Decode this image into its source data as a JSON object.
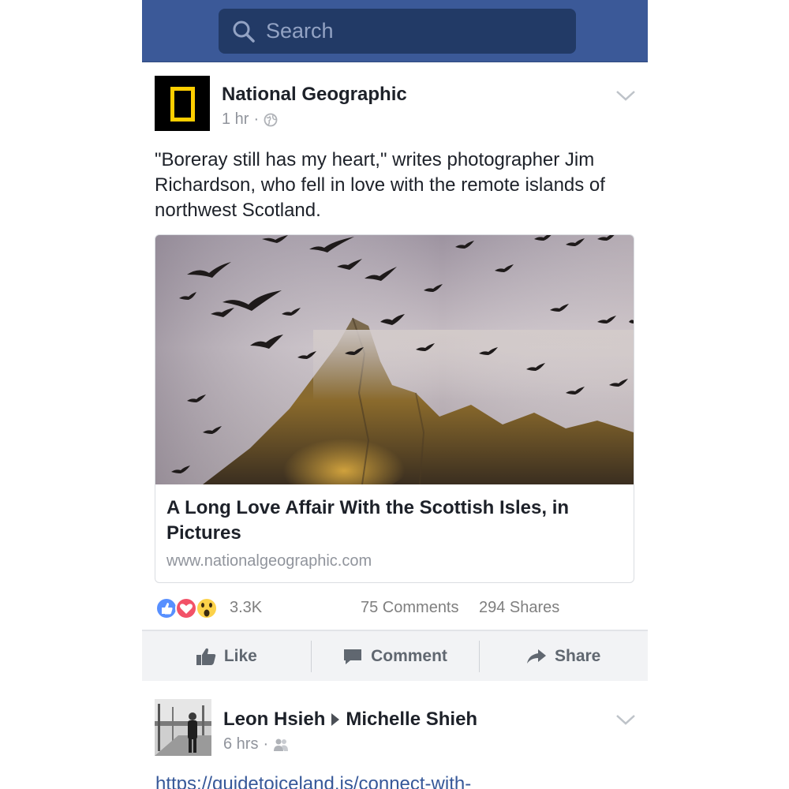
{
  "search": {
    "placeholder": "Search"
  },
  "post1": {
    "author": "National Geographic",
    "time": "1 hr",
    "meta_separator": "·",
    "text": "\"Boreray still has my heart,\" writes photographer Jim Richardson, who fell in love with the remote islands of northwest Scotland.",
    "link": {
      "title": "A Long Love Affair With the Scottish Isles, in Pictures",
      "domain": "www.nationalgeographic.com"
    },
    "reactions_count": "3.3K",
    "comments": "75 Comments",
    "shares": "294 Shares",
    "actions": {
      "like": "Like",
      "comment": "Comment",
      "share": "Share"
    }
  },
  "post2": {
    "author": "Leon Hsieh",
    "target": "Michelle Shieh",
    "time": "6 hrs",
    "meta_separator": "·",
    "link_text": "https://guidetoiceland.is/connect-with-"
  },
  "colors": {
    "header": "#3b5998",
    "search_bg": "#223a66",
    "like_blue": "#5890ff",
    "love_red": "#f25268",
    "wow_yellow": "#fcd24a",
    "link_blue": "#365899"
  }
}
